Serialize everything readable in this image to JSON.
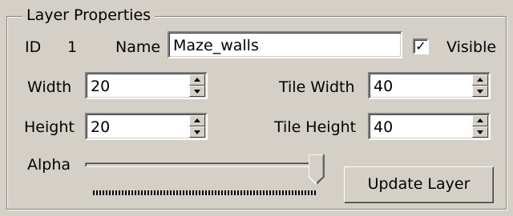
{
  "group": {
    "title": "Layer Properties"
  },
  "layer": {
    "id_label": "ID",
    "id_value": "1",
    "name_label": "Name",
    "name_value": "Maze_walls",
    "visible_label": "Visible",
    "visible_checked": true,
    "check_mark": "✓"
  },
  "size": {
    "width_label": "Width",
    "width_value": "20",
    "height_label": "Height",
    "height_value": "20",
    "tile_width_label": "Tile Width",
    "tile_width_value": "40",
    "tile_height_label": "Tile Height",
    "tile_height_value": "40"
  },
  "alpha": {
    "label": "Alpha",
    "level": 1.0
  },
  "actions": {
    "update_label": "Update Layer"
  }
}
